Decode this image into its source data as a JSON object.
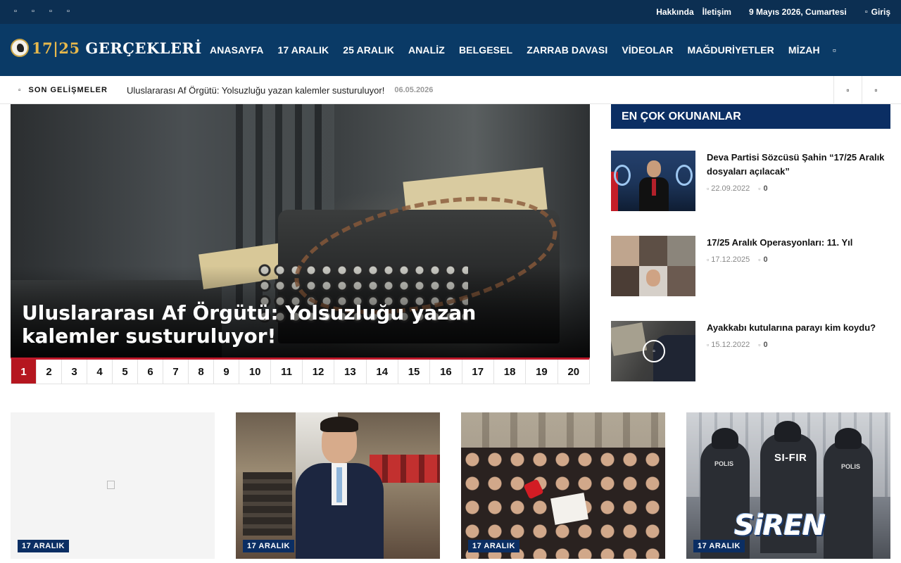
{
  "topbar": {
    "social_icons": [
      "facebook-icon",
      "twitter-icon",
      "instagram-icon",
      "youtube-icon"
    ],
    "about": "Hakkında",
    "contact": "İletişim",
    "date": "9 Mayıs 2026, Cumartesi",
    "login": "Giriş"
  },
  "header": {
    "logo_numbers": "17|25",
    "logo_word": "GERÇEKLERİ",
    "nav": [
      "ANASAYFA",
      "17 ARALIK",
      "25 ARALIK",
      "ANALİZ",
      "BELGESEL",
      "ZARRAB DAVASI",
      "VİDEOLAR",
      "MAĞDURİYETLER",
      "MİZAH"
    ]
  },
  "ticker": {
    "label": "SON GELİŞMELER",
    "headline": "Uluslararası Af Örgütü: Yolsuzluğu yazan kalemler susturuluyor!",
    "date": "06.05.2026"
  },
  "slider": {
    "caption": "Uluslararası Af Örgütü: Yolsuzluğu yazan kalemler susturuluyor!",
    "pages": [
      "1",
      "2",
      "3",
      "4",
      "5",
      "6",
      "7",
      "8",
      "9",
      "10",
      "11",
      "12",
      "13",
      "14",
      "15",
      "16",
      "17",
      "18",
      "19",
      "20"
    ],
    "active_page": "1"
  },
  "sidebar": {
    "title": "EN ÇOK OKUNANLAR",
    "items": [
      {
        "title": "Deva Partisi Sözcüsü Şahin “17/25 Aralık dosyaları açılacak”",
        "date": "22.09.2022",
        "comments": "0"
      },
      {
        "title": "17/25 Aralık Operasyonları: 11. Yıl",
        "date": "17.12.2025",
        "comments": "0"
      },
      {
        "title": "Ayakkabı kutularına parayı kim koydu?",
        "date": "15.12.2022",
        "comments": "0"
      }
    ]
  },
  "cards": [
    {
      "tag": "17 ARALIK"
    },
    {
      "tag": "17 ARALIK"
    },
    {
      "tag": "17 ARALIK"
    },
    {
      "tag": "17 ARALIK",
      "image_text": {
        "polis": "POLIS",
        "sifir": "SI-FIR",
        "siren": "SiREN"
      }
    }
  ],
  "colors": {
    "topbar": "#0c2f52",
    "header": "#0a3a66",
    "accent_red": "#b5161f",
    "tag_bg": "#0b2e63"
  }
}
